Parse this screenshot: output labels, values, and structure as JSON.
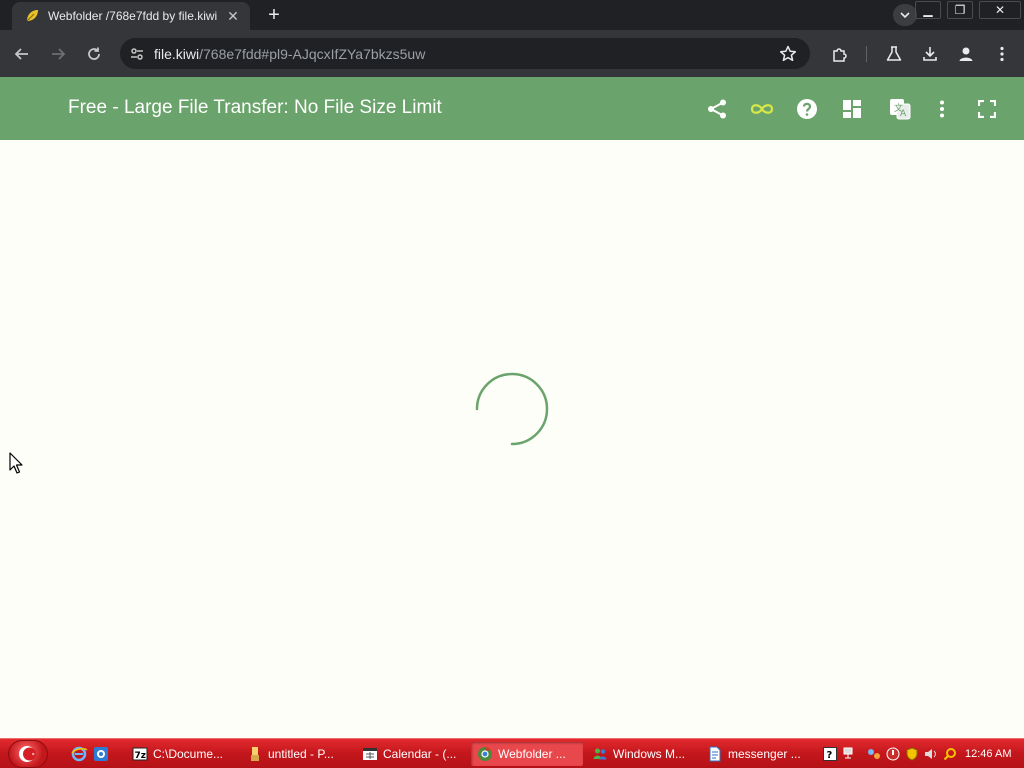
{
  "browser": {
    "tab_title": "Webfolder /768e7fdd by file.kiwi",
    "url_domain": "file.kiwi",
    "url_rest": "/768e7fdd#pl9-AJqcxIfZYa7bkzs5uw"
  },
  "app": {
    "title": "Free - Large File Transfer: No File Size Limit",
    "accent_color": "#6aa36b",
    "infinity_color": "#d8e84a",
    "icons": [
      "share-icon",
      "infinity-icon",
      "help-icon",
      "dashboard-icon",
      "translate-icon",
      "more-vertical-icon",
      "fullscreen-icon"
    ]
  },
  "content": {
    "state": "loading",
    "spinner_color": "#6aa36b"
  },
  "taskbar": {
    "tasks": [
      {
        "label": "C:\\Docume...",
        "icon": "7zip-icon"
      },
      {
        "label": "untitled - P...",
        "icon": "paint-icon"
      },
      {
        "label": "Calendar - (...",
        "icon": "calendar-icon"
      },
      {
        "label": "Webfolder ...",
        "icon": "chrome-icon"
      },
      {
        "label": "Windows M...",
        "icon": "messenger-icon"
      },
      {
        "label": "messenger ...",
        "icon": "document-icon"
      }
    ],
    "clock": "12:46 AM"
  }
}
